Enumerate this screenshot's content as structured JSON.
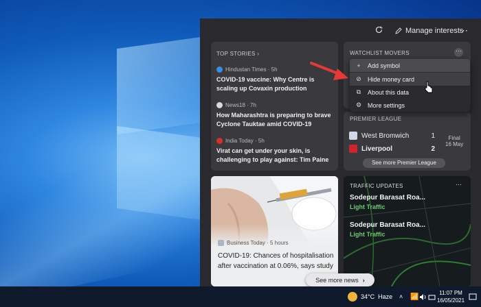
{
  "header": {
    "refresh_icon": "refresh-icon",
    "manage_label": "Manage interests",
    "more_icon": "more-icon"
  },
  "top_stories": {
    "title": "TOP STORIES",
    "chevron": "›",
    "items": [
      {
        "source": "Hindustan Times · 5h",
        "badge_color": "#3a8ee6",
        "headline": "COVID-19 vaccine: Why Centre is scaling up Covaxin production"
      },
      {
        "source": "News18 · 7h",
        "badge_color": "#d9d9d9",
        "headline": "How Maharashtra is preparing to brave Cyclone Tauktae amid COVID-19"
      },
      {
        "source": "India Today · 5h",
        "badge_color": "#d93025",
        "headline": "Virat can get under your skin, is challenging to play against: Tim Paine"
      }
    ]
  },
  "watchlist": {
    "title": "WATCHLIST MOVERS",
    "menu": [
      {
        "icon": "+",
        "label": "Add symbol"
      },
      {
        "icon": "⊘",
        "label": "Hide money card"
      },
      {
        "icon": "⧉",
        "label": "About this data"
      },
      {
        "icon": "⚙",
        "label": "More settings"
      }
    ]
  },
  "premier": {
    "title": "PREMIER LEAGUE",
    "teams": [
      {
        "name": "West Bromwich",
        "score": "1",
        "color": "#cfd8e6"
      },
      {
        "name": "Liverpool",
        "score": "2",
        "color": "#d0242c"
      }
    ],
    "status": "Final",
    "date": "16 May",
    "see_more": "See more Premier League"
  },
  "health": {
    "source": "Business Today · 5 hours",
    "headline": "COVID-19: Chances of hospitalisation after vaccination at 0.06%, says study"
  },
  "traffic": {
    "title": "TRAFFIC UPDATES",
    "items": [
      {
        "route": "Sodepur Barasat Roa...",
        "status": "Light Traffic"
      },
      {
        "route": "Sodepur Barasat Roa...",
        "status": "Light Traffic"
      }
    ]
  },
  "see_more_news": "See more news",
  "taskbar": {
    "temperature": "34°C",
    "weather": "Haze",
    "time": "11:07 PM",
    "date": "16/05/2021"
  },
  "colors": {
    "panel_bg": "#2a2a2e",
    "card_bg": "#3a3a3e",
    "light_traffic": "#6ccc70",
    "arrow": "#e53935"
  }
}
